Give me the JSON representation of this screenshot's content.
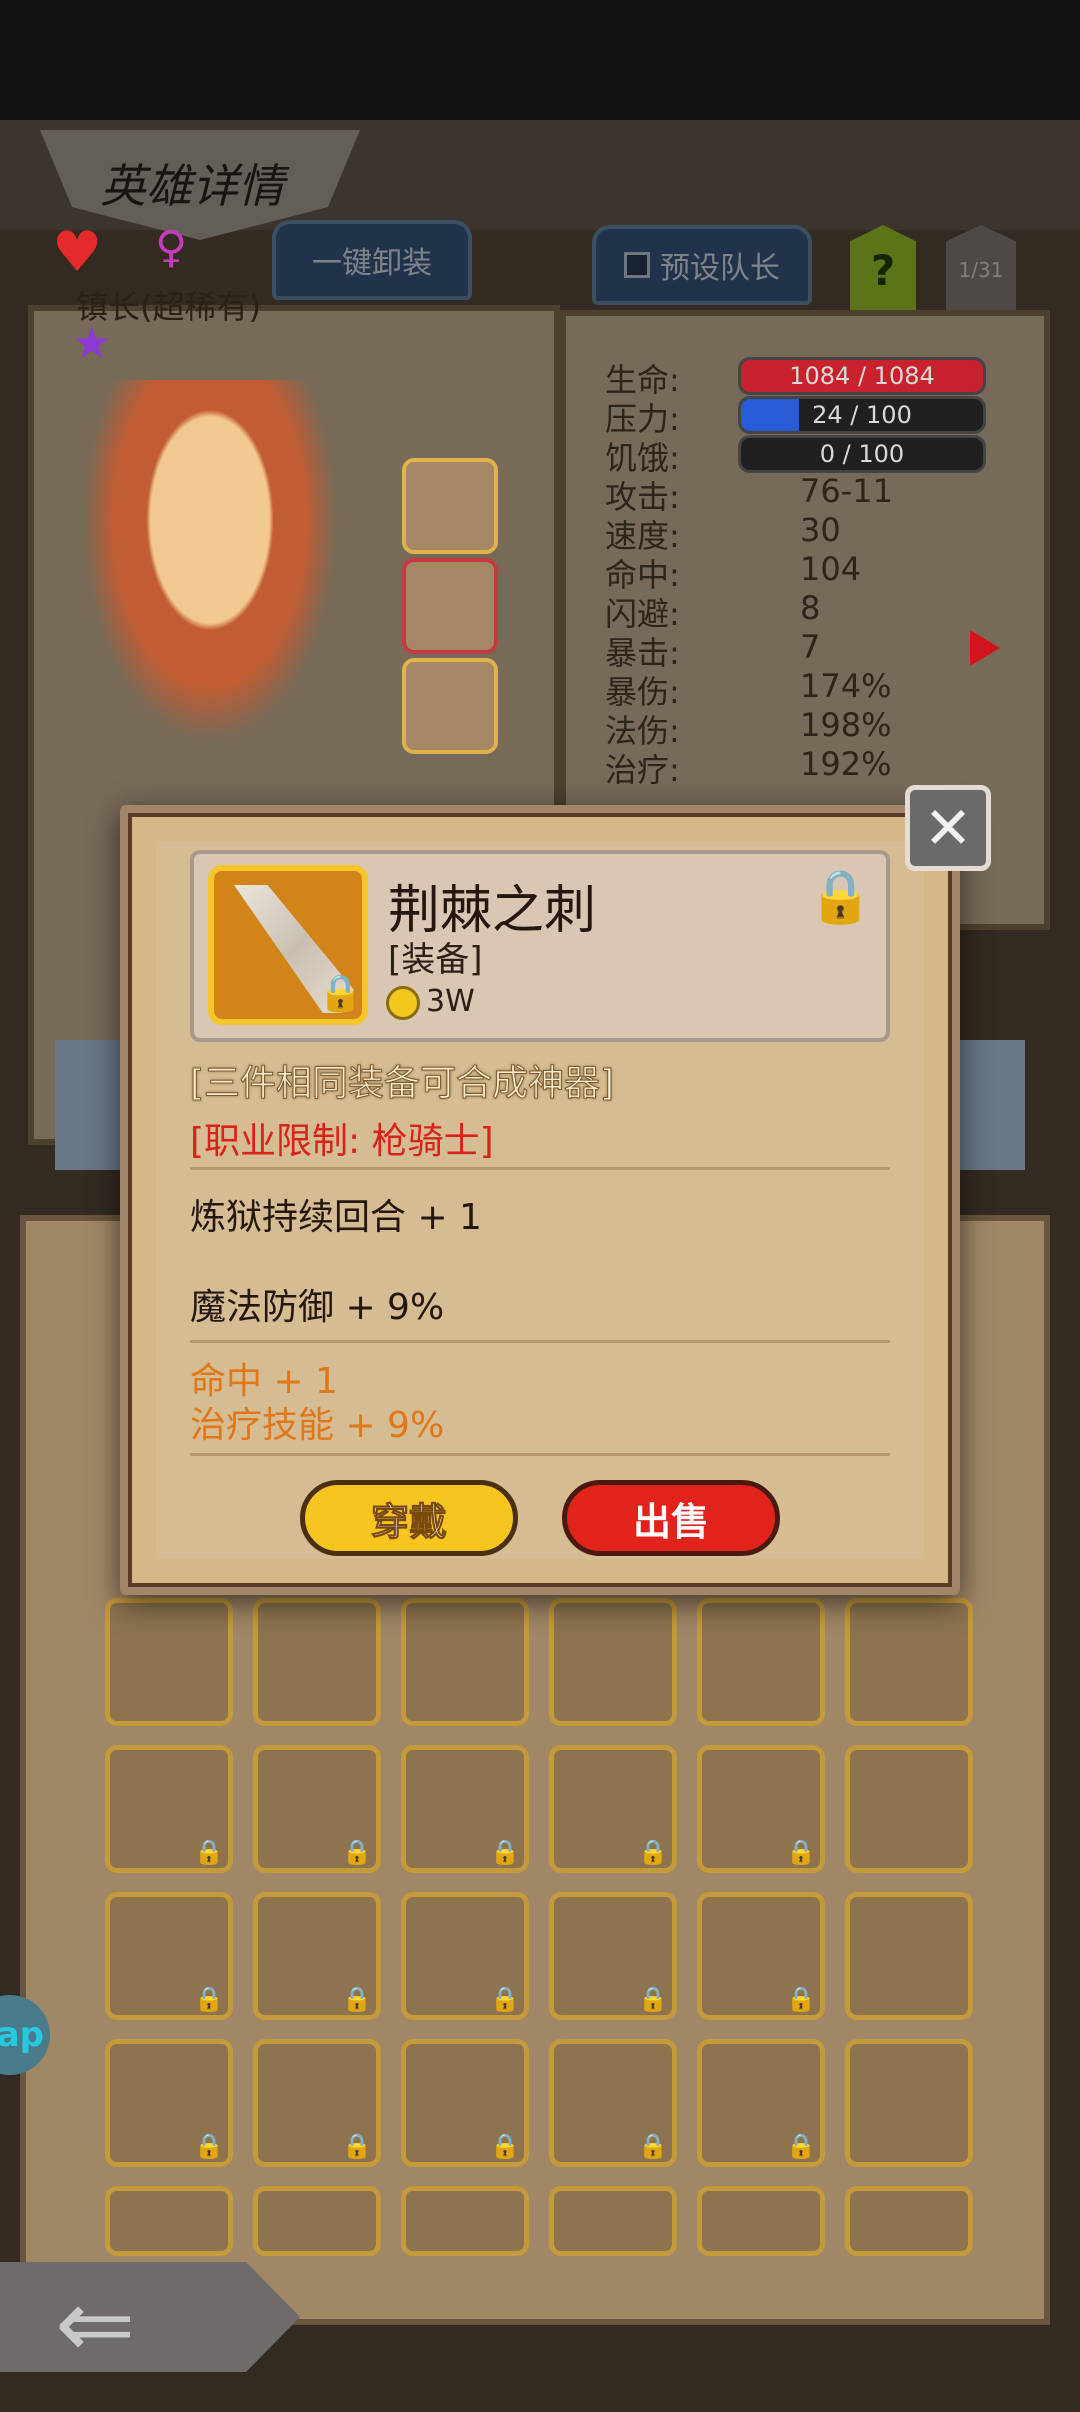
{
  "header": {
    "title": "英雄详情"
  },
  "top_buttons": {
    "unequip_all": "一键卸装",
    "preset_team": "预设队长",
    "help": "?",
    "page": "1/31"
  },
  "hero": {
    "name": "镇长(超稀有)"
  },
  "stats": [
    {
      "label": "生命:",
      "bar": "1084 / 1084",
      "fill": 1.0,
      "color": "#c8232d"
    },
    {
      "label": "压力:",
      "bar": "24 / 100",
      "fill": 0.24,
      "color": "#2a5bd6"
    },
    {
      "label": "饥饿:",
      "bar": "0 / 100",
      "fill": 0.0,
      "color": "#2a5bd6"
    },
    {
      "label": "攻击:",
      "value": "76-11"
    },
    {
      "label": "速度:",
      "value": "30"
    },
    {
      "label": "命中:",
      "value": "104"
    },
    {
      "label": "闪避:",
      "value": "8"
    },
    {
      "label": "暴击:",
      "value": "7"
    },
    {
      "label": "暴伤:",
      "value": "174%"
    },
    {
      "label": "法伤:",
      "value": "198%"
    },
    {
      "label": "治疗:",
      "value": "192%"
    }
  ],
  "item": {
    "name": "荆棘之刺",
    "type": "[装备]",
    "price": "3W",
    "synth_note": "[三件相同装备可合成神器]",
    "class_limit": "[职业限制: 枪骑士]",
    "attr1": "炼狱持续回合 + 1",
    "attr2": "魔法防御 + 9%",
    "bonus1": "命中 + 1",
    "bonus2": "治疗技能 + 9%"
  },
  "modal_buttons": {
    "equip": "穿戴",
    "sell": "出售"
  },
  "colors": {
    "gold_button": "#f7c51f",
    "red_button": "#e2231c",
    "orange_text": "#e0781a",
    "red_text": "#d8231b"
  },
  "icons": [
    "heart-icon",
    "female-icon",
    "star-icon",
    "lock-icon",
    "coin-icon",
    "close-icon",
    "back-arrow-icon"
  ],
  "overlay": {
    "app_badge": "ap"
  }
}
